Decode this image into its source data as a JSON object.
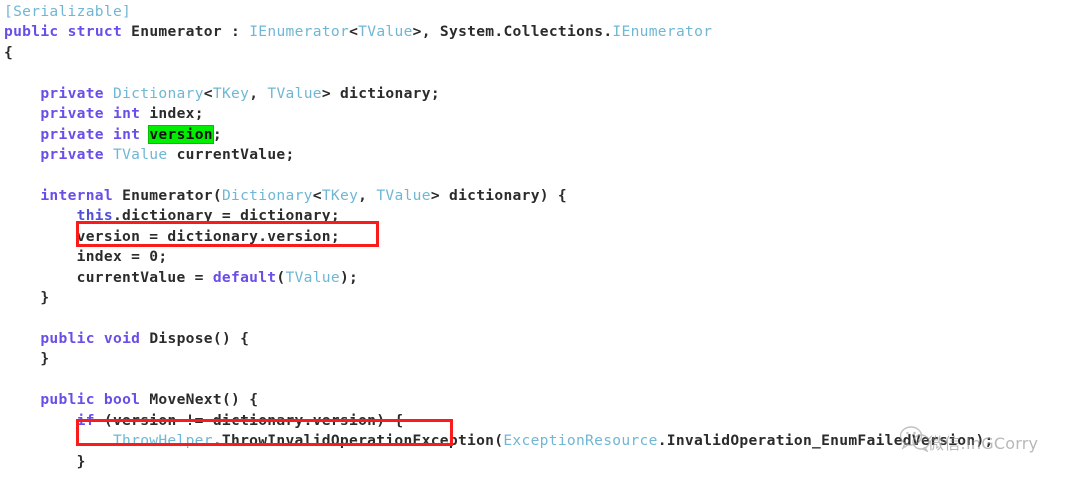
{
  "editor": {
    "language": "C#",
    "background_color": "#ffffff",
    "font_size_px": 14.6,
    "colors": {
      "keyword": "#6a4ee8",
      "type": "#6fb7d4",
      "identifier": "#2b2b2b",
      "highlight_green": "#00ef00",
      "annotation_red": "#fb1b1b",
      "watermark_gray": "#8e8e8e"
    },
    "lines": [
      {
        "n": 1,
        "indent": 0,
        "tokens": [
          {
            "t": "[Serializable]",
            "c": "type"
          }
        ]
      },
      {
        "n": 2,
        "indent": 0,
        "tokens": [
          {
            "t": "public",
            "c": "kw"
          },
          {
            "t": " ",
            "c": "plain"
          },
          {
            "t": "struct",
            "c": "kw"
          },
          {
            "t": " ",
            "c": "plain"
          },
          {
            "t": "Enumerator",
            "c": "ident"
          },
          {
            "t": " : ",
            "c": "plain"
          },
          {
            "t": "IEnumerator",
            "c": "type"
          },
          {
            "t": "<",
            "c": "plain"
          },
          {
            "t": "TValue",
            "c": "type"
          },
          {
            "t": ">, ",
            "c": "plain"
          },
          {
            "t": "System.Collections.",
            "c": "ident"
          },
          {
            "t": "IEnumerator",
            "c": "type"
          }
        ]
      },
      {
        "n": 3,
        "indent": 0,
        "tokens": [
          {
            "t": "{",
            "c": "plain"
          }
        ]
      },
      {
        "n": 4,
        "indent": 0,
        "tokens": []
      },
      {
        "n": 5,
        "indent": 1,
        "tokens": [
          {
            "t": "private",
            "c": "kw"
          },
          {
            "t": " ",
            "c": "plain"
          },
          {
            "t": "Dictionary",
            "c": "type"
          },
          {
            "t": "<",
            "c": "plain"
          },
          {
            "t": "TKey",
            "c": "type"
          },
          {
            "t": ", ",
            "c": "plain"
          },
          {
            "t": "TValue",
            "c": "type"
          },
          {
            "t": "> ",
            "c": "plain"
          },
          {
            "t": "dictionary;",
            "c": "ident"
          }
        ]
      },
      {
        "n": 6,
        "indent": 1,
        "tokens": [
          {
            "t": "private",
            "c": "kw"
          },
          {
            "t": " ",
            "c": "plain"
          },
          {
            "t": "int",
            "c": "kw"
          },
          {
            "t": " ",
            "c": "plain"
          },
          {
            "t": "index;",
            "c": "ident"
          }
        ]
      },
      {
        "n": 7,
        "indent": 1,
        "tokens": [
          {
            "t": "private",
            "c": "kw"
          },
          {
            "t": " ",
            "c": "plain"
          },
          {
            "t": "int",
            "c": "kw"
          },
          {
            "t": " ",
            "c": "plain"
          },
          {
            "t": "version",
            "c": "hl-green"
          },
          {
            "t": ";",
            "c": "ident"
          }
        ]
      },
      {
        "n": 8,
        "indent": 1,
        "tokens": [
          {
            "t": "private",
            "c": "kw"
          },
          {
            "t": " ",
            "c": "plain"
          },
          {
            "t": "TValue",
            "c": "type"
          },
          {
            "t": " ",
            "c": "plain"
          },
          {
            "t": "currentValue;",
            "c": "ident"
          }
        ]
      },
      {
        "n": 9,
        "indent": 0,
        "tokens": []
      },
      {
        "n": 10,
        "indent": 1,
        "tokens": [
          {
            "t": "internal",
            "c": "kw"
          },
          {
            "t": " ",
            "c": "plain"
          },
          {
            "t": "Enumerator(",
            "c": "ident"
          },
          {
            "t": "Dictionary",
            "c": "type"
          },
          {
            "t": "<",
            "c": "plain"
          },
          {
            "t": "TKey",
            "c": "type"
          },
          {
            "t": ", ",
            "c": "plain"
          },
          {
            "t": "TValue",
            "c": "type"
          },
          {
            "t": "> ",
            "c": "plain"
          },
          {
            "t": "dictionary) {",
            "c": "ident"
          }
        ]
      },
      {
        "n": 11,
        "indent": 2,
        "tokens": [
          {
            "t": "this",
            "c": "this"
          },
          {
            "t": ".dictionary = dictionary;",
            "c": "ident"
          }
        ]
      },
      {
        "n": 12,
        "indent": 2,
        "tokens": [
          {
            "t": "version = dictionary.version;",
            "c": "ident"
          }
        ]
      },
      {
        "n": 13,
        "indent": 2,
        "tokens": [
          {
            "t": "index = ",
            "c": "ident"
          },
          {
            "t": "0",
            "c": "num"
          },
          {
            "t": ";",
            "c": "ident"
          }
        ]
      },
      {
        "n": 14,
        "indent": 2,
        "tokens": [
          {
            "t": "currentValue = ",
            "c": "ident"
          },
          {
            "t": "default",
            "c": "kw"
          },
          {
            "t": "(",
            "c": "plain"
          },
          {
            "t": "TValue",
            "c": "type"
          },
          {
            "t": ");",
            "c": "plain"
          }
        ]
      },
      {
        "n": 15,
        "indent": 1,
        "tokens": [
          {
            "t": "}",
            "c": "plain"
          }
        ]
      },
      {
        "n": 16,
        "indent": 0,
        "tokens": []
      },
      {
        "n": 17,
        "indent": 1,
        "tokens": [
          {
            "t": "public",
            "c": "kw"
          },
          {
            "t": " ",
            "c": "plain"
          },
          {
            "t": "void",
            "c": "kw"
          },
          {
            "t": " ",
            "c": "plain"
          },
          {
            "t": "Dispose() {",
            "c": "ident"
          }
        ]
      },
      {
        "n": 18,
        "indent": 1,
        "tokens": [
          {
            "t": "}",
            "c": "plain"
          }
        ]
      },
      {
        "n": 19,
        "indent": 0,
        "tokens": []
      },
      {
        "n": 20,
        "indent": 1,
        "tokens": [
          {
            "t": "public",
            "c": "kw"
          },
          {
            "t": " ",
            "c": "plain"
          },
          {
            "t": "bool",
            "c": "kw"
          },
          {
            "t": " ",
            "c": "plain"
          },
          {
            "t": "MoveNext() {",
            "c": "ident"
          }
        ]
      },
      {
        "n": 21,
        "indent": 2,
        "tokens": [
          {
            "t": "if",
            "c": "kw"
          },
          {
            "t": " (version != dictionary.version) {",
            "c": "ident"
          }
        ]
      },
      {
        "n": 22,
        "indent": 3,
        "tokens": [
          {
            "t": "ThrowHelper",
            "c": "type"
          },
          {
            "t": ".ThrowInvalidOperationException(",
            "c": "ident"
          },
          {
            "t": "ExceptionResource",
            "c": "type"
          },
          {
            "t": ".InvalidOperation_EnumFailedVersion",
            "c": "ident"
          },
          {
            "t": ");",
            "c": "ident"
          }
        ]
      },
      {
        "n": 23,
        "indent": 2,
        "tokens": [
          {
            "t": "}",
            "c": "plain"
          }
        ]
      }
    ]
  },
  "annotations": {
    "boxes": [
      {
        "id": "redbox-assign",
        "label": "version = dictionary.version;",
        "color": "#fb1b1b"
      },
      {
        "id": "redbox-if",
        "label": "if (version != dictionary.version) {",
        "color": "#fb1b1b"
      }
    ],
    "highlights": [
      {
        "label": "version",
        "color": "#00ef00"
      }
    ]
  },
  "watermark": {
    "text": "微信:InGCorry",
    "icon": "wechat-icon",
    "color": "#8e8e8e"
  }
}
